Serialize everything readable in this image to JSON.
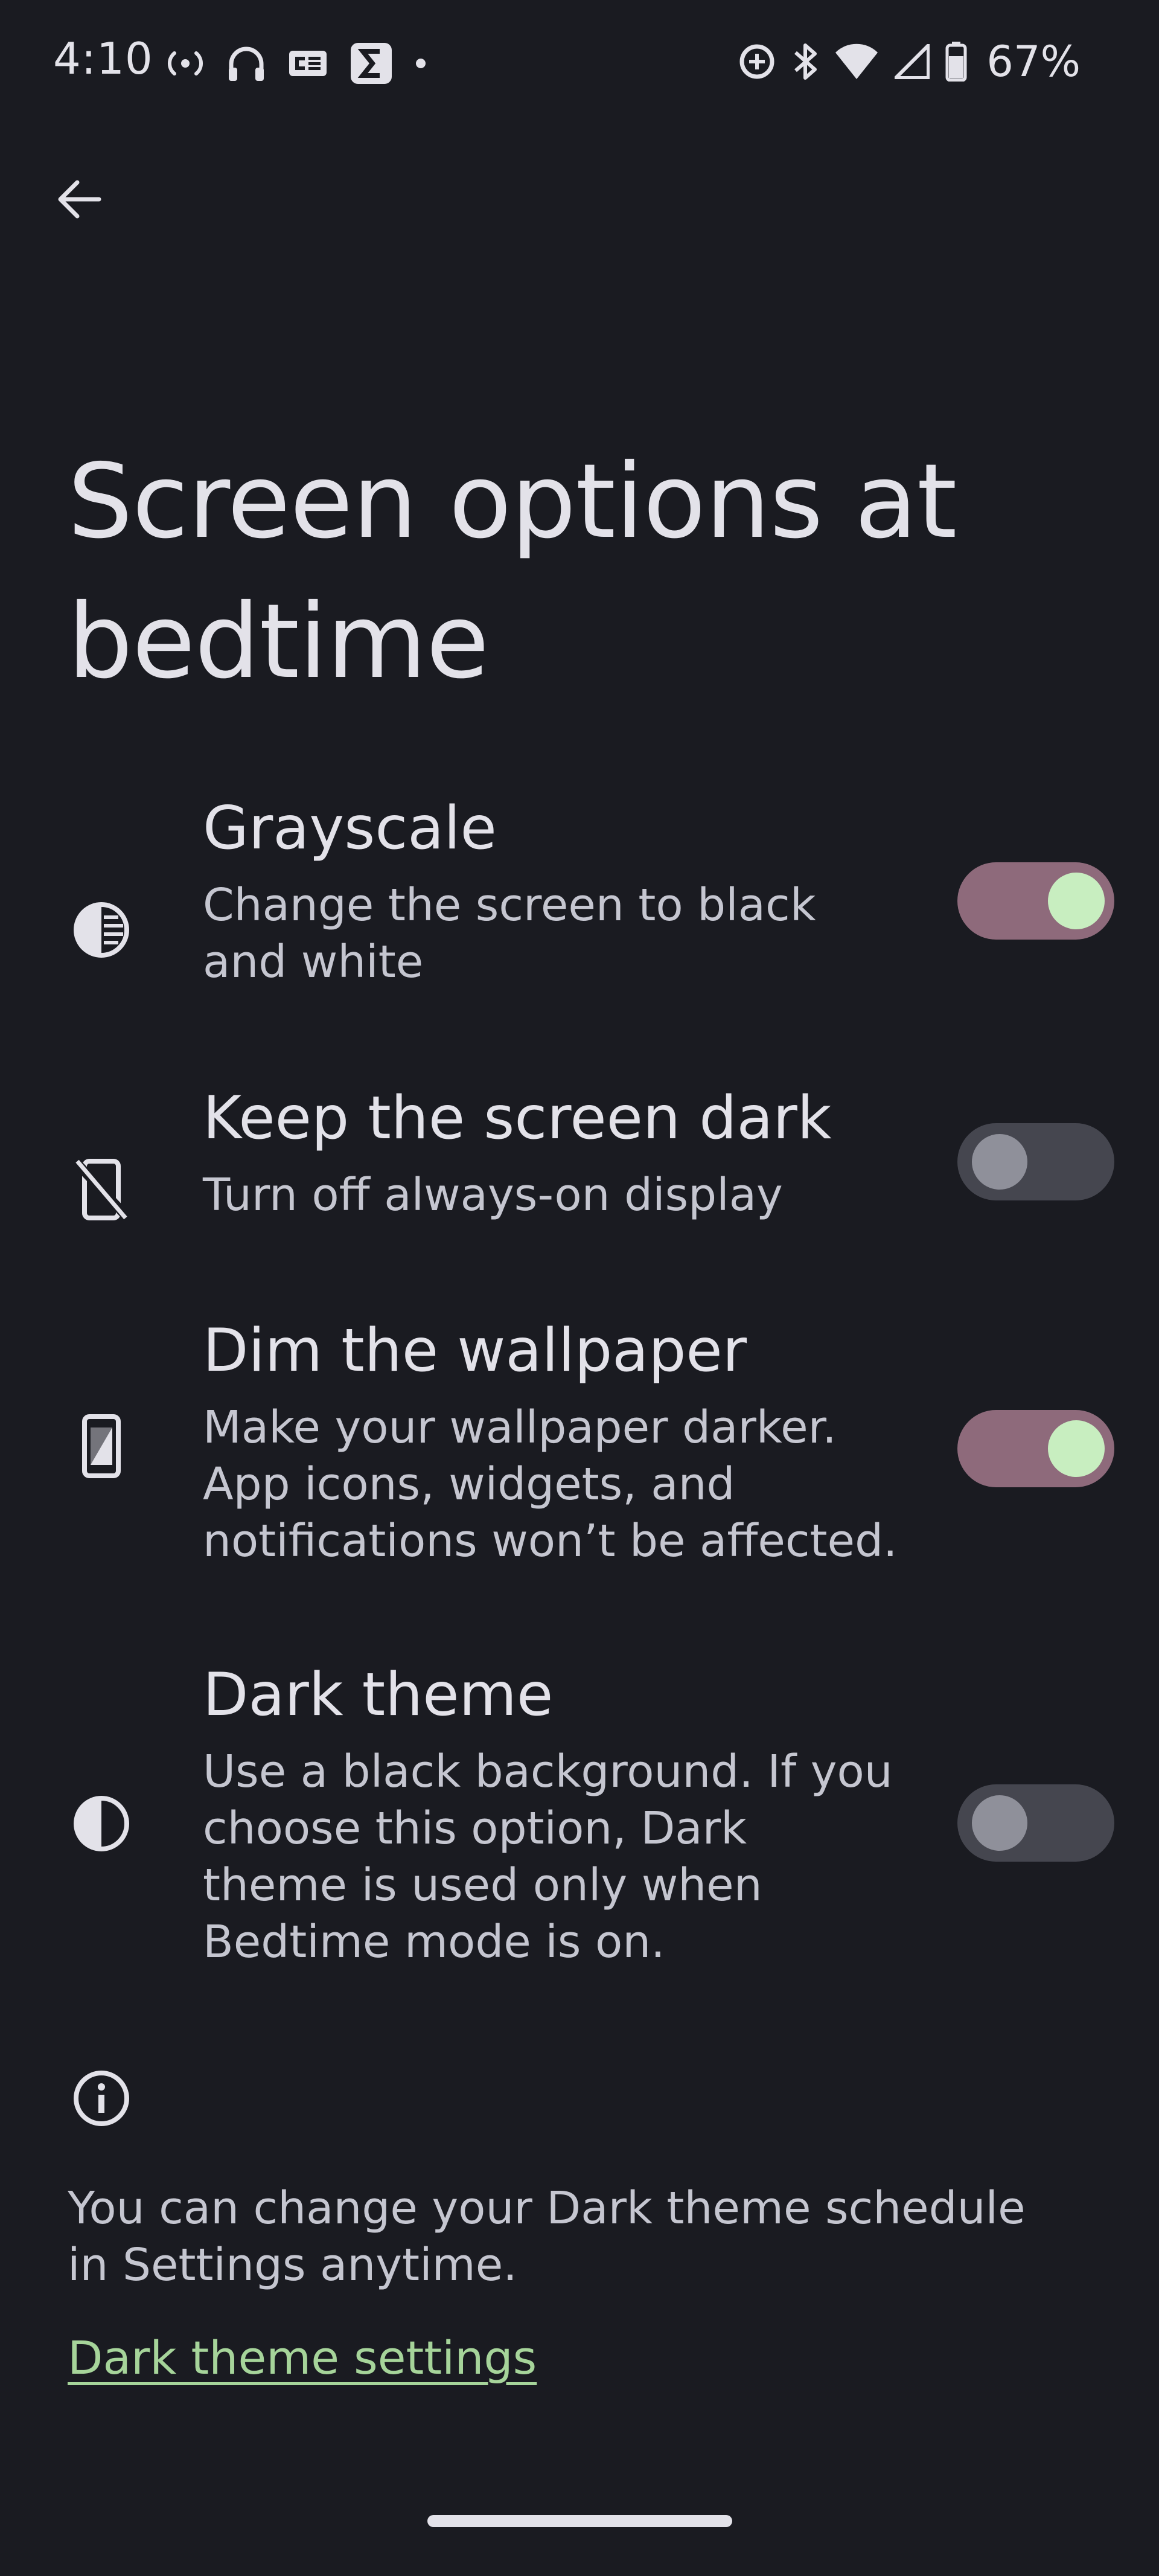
{
  "status_bar": {
    "time": "4:10",
    "battery_text": "67%",
    "left_icons": [
      "hotspot-icon",
      "headphones-icon",
      "ge-app-icon",
      "sigma-app-icon",
      "notification-dot-icon"
    ],
    "right_icons": [
      "data-saver-icon",
      "bluetooth-icon",
      "wifi-icon",
      "cell-signal-icon",
      "battery-icon"
    ]
  },
  "header": {
    "back_icon": "arrow-left-icon",
    "title": "Screen options at bedtime"
  },
  "settings": [
    {
      "title": "Grayscale",
      "summary": "Change the screen to black and white",
      "icon": "grayscale-icon",
      "enabled": true
    },
    {
      "title": "Keep the screen dark",
      "summary": "Turn off always-on display",
      "icon": "screen-off-icon",
      "enabled": false
    },
    {
      "title": "Dim the wallpaper",
      "summary": "Make your wallpaper darker. App icons, widgets, and notifications won’t be affected.",
      "icon": "wallpaper-dim-icon",
      "enabled": true
    },
    {
      "title": "Dark theme",
      "summary": "Use a black background. If you choose this option, Dark theme is used only when Bedtime mode is on.",
      "icon": "dark-theme-icon",
      "enabled": false
    }
  ],
  "info": {
    "icon": "info-icon",
    "text": "You can change your Dark theme schedule in Settings anytime.",
    "link_label": "Dark theme settings"
  },
  "colors": {
    "background": "#1a1b21",
    "toggle_on_track": "#8e6a7b",
    "toggle_on_thumb": "#c8eec0",
    "toggle_off_track": "#45464f",
    "toggle_off_thumb": "#8f909a",
    "link": "#a6d49a"
  }
}
